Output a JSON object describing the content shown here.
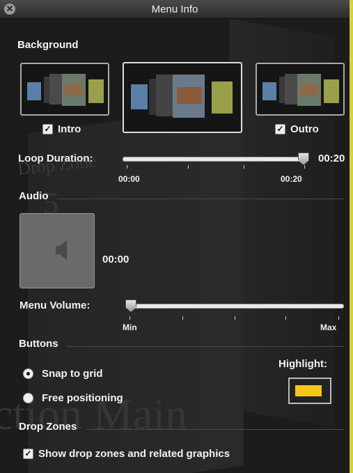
{
  "window": {
    "title": "Menu Info"
  },
  "background": {
    "heading": "Background",
    "intro_label": "Intro",
    "intro_checked": true,
    "outro_label": "Outro",
    "outro_checked": true
  },
  "loop": {
    "label": "Loop Duration:",
    "value": "00:20",
    "min_label": "00:00",
    "max_label": "00:20",
    "level": 1.0
  },
  "audio": {
    "heading": "Audio",
    "duration": "00:00",
    "well_icon": "speaker-icon"
  },
  "volume": {
    "label": "Menu Volume:",
    "min_label": "Min",
    "max_label": "Max",
    "level": 0.0
  },
  "buttons": {
    "heading": "Buttons",
    "snap_label": "Snap to grid",
    "free_label": "Free positioning",
    "selected": "snap",
    "highlight_label": "Highlight:",
    "highlight_color": "#f5c518"
  },
  "drop_zones": {
    "heading": "Drop Zones",
    "show_label": "Show drop zones and related graphics",
    "show_checked": true
  },
  "background_text": {
    "drop_zone": "Drop Zone",
    "number": "5",
    "main": "ction Main"
  }
}
